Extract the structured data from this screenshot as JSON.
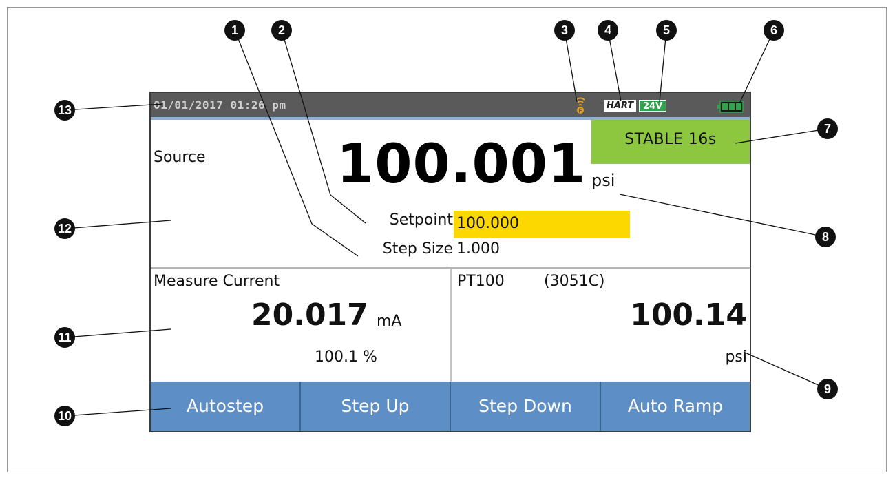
{
  "status": {
    "datetime": "01/01/2017 01:26 pm",
    "wireless_icon": "wireless-signal-icon",
    "hart_badge": "HART",
    "loop_power": "24V",
    "battery_icon": "battery-icon"
  },
  "source": {
    "label": "Source",
    "value": "100.001",
    "unit": "psi",
    "stable": "STABLE 16s",
    "setpoint_label": "Setpoint",
    "setpoint_value": "100.000",
    "stepsize_label": "Step Size",
    "stepsize_value": "1.000"
  },
  "measure": {
    "label": "Measure Current",
    "value": "20.017",
    "unit": "mA",
    "percent": "100.1 %"
  },
  "hart": {
    "tag": "PT100",
    "model": "(3051C)",
    "value": "100.14",
    "unit": "psi"
  },
  "softkeys": [
    "Autostep",
    "Step Up",
    "Step Down",
    "Auto Ramp"
  ],
  "callouts": [
    "1",
    "2",
    "3",
    "4",
    "5",
    "6",
    "7",
    "8",
    "9",
    "10",
    "11",
    "12",
    "13"
  ],
  "colors": {
    "status_bar": "#5a5a5a",
    "stable": "#8dc63f",
    "setpoint_highlight": "#fcd800",
    "softkey": "#5d8ec6",
    "loop_power": "#2fa44a"
  }
}
